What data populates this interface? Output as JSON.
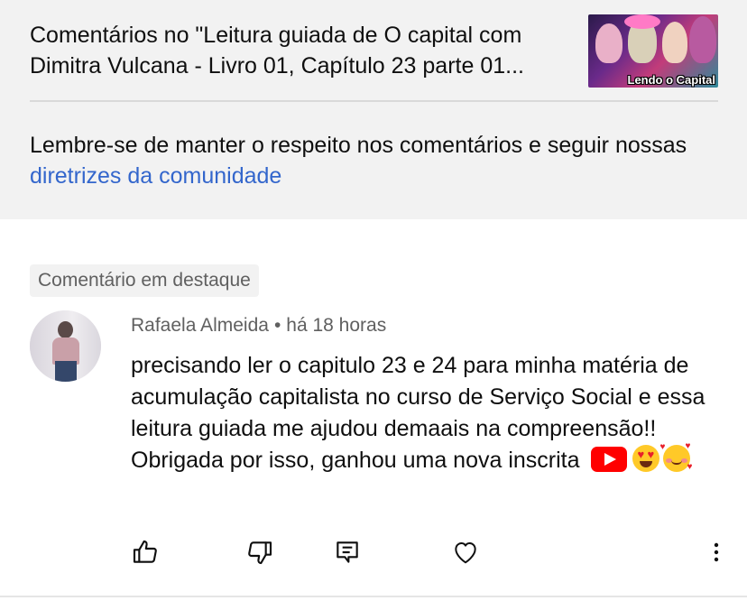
{
  "header": {
    "video_title": "Comentários no \"Leitura guiada de O capital com Dimitra Vulcana - Livro 01, Capítulo 23 parte 01...",
    "thumbnail_caption": "Lendo o Capital",
    "guidelines_text": "Lembre-se de manter o respeito nos comentários e seguir nossas ",
    "guidelines_link": "diretrizes da comunidade"
  },
  "comment": {
    "badge": "Comentário em destaque",
    "author": "Rafaela Almeida",
    "separator": "•",
    "time": "há 18 horas",
    "text": "precisando ler o capitulo 23 e 24 para minha matéria de acumulação capitalista no curso de Serviço Social e essa leitura guiada me ajudou demaais na compreensão!! Obrigada por isso, ganhou uma nova inscrita",
    "emojis": [
      "youtube-play-emoji",
      "heart-eyes-emoji",
      "smiling-face-with-hearts-emoji"
    ]
  },
  "actions": {
    "icons": [
      "thumbs-up-icon",
      "thumbs-down-icon",
      "reply-icon",
      "heart-icon",
      "more-vert-icon"
    ]
  },
  "colors": {
    "header_bg": "#f2f2f2",
    "link": "#3366cc",
    "secondary_text": "#606060",
    "primary_text": "#0f0f0f"
  }
}
